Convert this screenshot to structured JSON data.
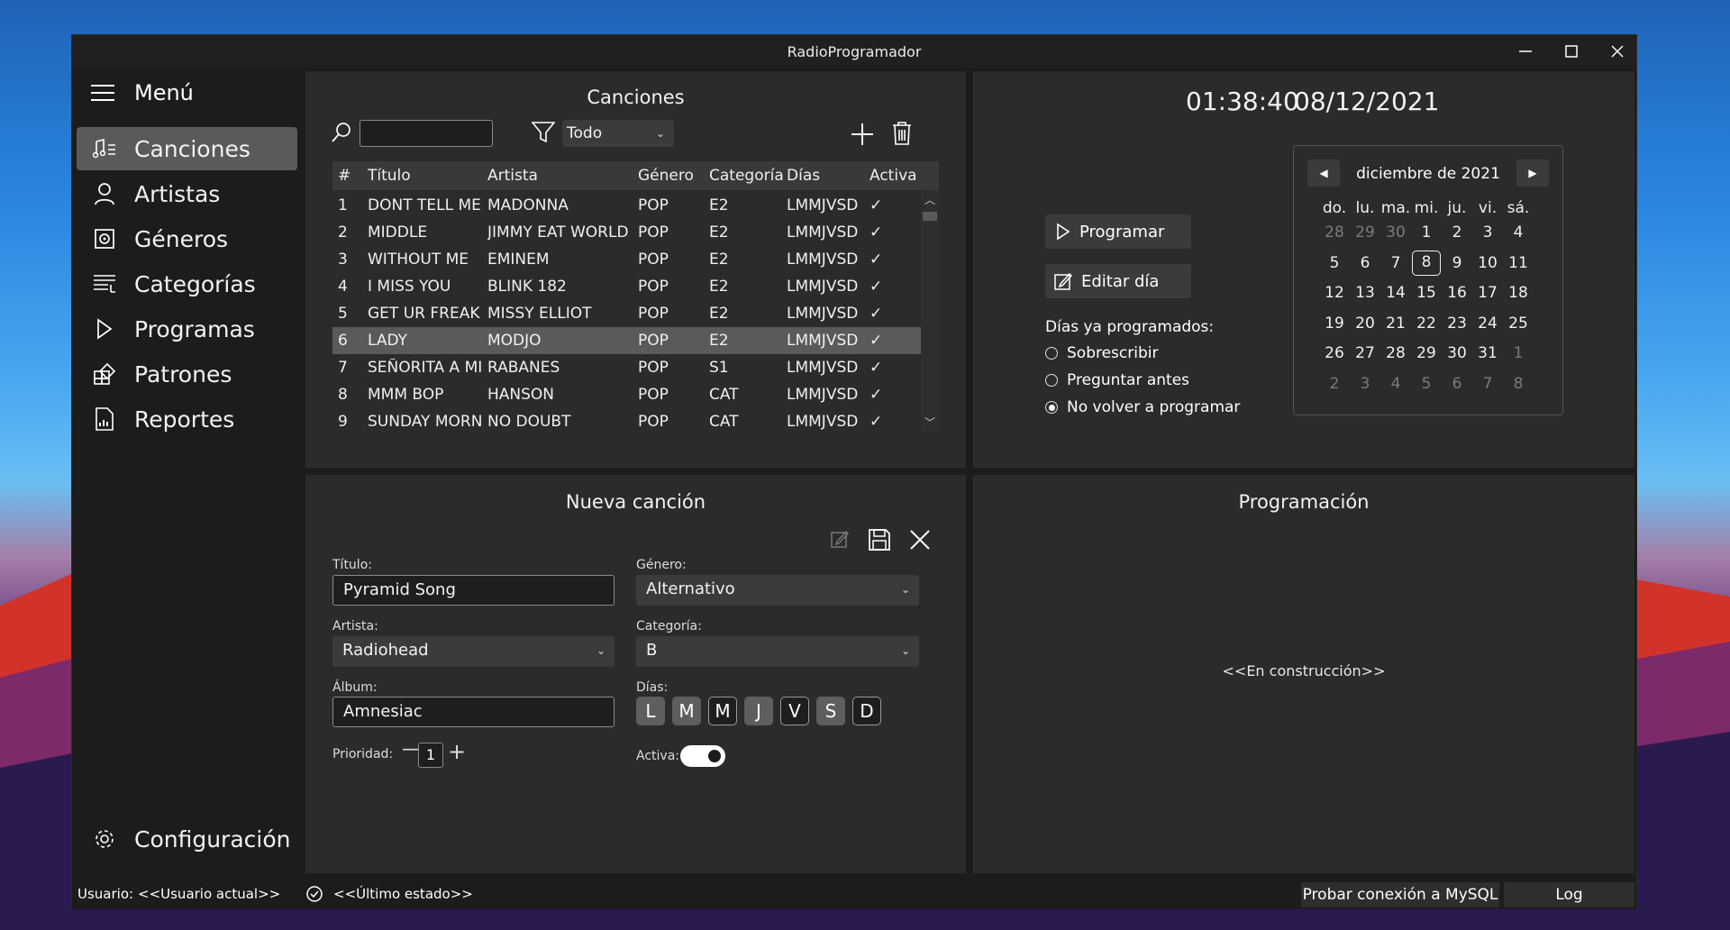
{
  "window": {
    "title": "RadioProgramador"
  },
  "sidebar": {
    "menu_label": "Menú",
    "items": [
      {
        "label": "Canciones"
      },
      {
        "label": "Artistas"
      },
      {
        "label": "Géneros"
      },
      {
        "label": "Categorías"
      },
      {
        "label": "Programas"
      },
      {
        "label": "Patrones"
      },
      {
        "label": "Reportes"
      }
    ],
    "selected": "Canciones",
    "settings_label": "Configuración"
  },
  "songs": {
    "title": "Canciones",
    "search": {
      "value": ""
    },
    "filter": {
      "selected": "Todo"
    },
    "columns": [
      "#",
      "Título",
      "Artista",
      "Género",
      "Categoría",
      "Días",
      "Activa"
    ],
    "rows": [
      {
        "n": "1",
        "title": "DONT TELL ME",
        "artist": "MADONNA",
        "genre": "POP",
        "cat": "E2",
        "days": "LMMJVSD",
        "active": "✓"
      },
      {
        "n": "2",
        "title": "MIDDLE",
        "artist": "JIMMY EAT WORLD",
        "genre": "POP",
        "cat": "E2",
        "days": "LMMJVSD",
        "active": "✓"
      },
      {
        "n": "3",
        "title": "WITHOUT ME",
        "artist": "EMINEM",
        "genre": "POP",
        "cat": "E2",
        "days": "LMMJVSD",
        "active": "✓"
      },
      {
        "n": "4",
        "title": "I MISS YOU",
        "artist": "BLINK 182",
        "genre": "POP",
        "cat": "E2",
        "days": "LMMJVSD",
        "active": "✓"
      },
      {
        "n": "5",
        "title": "GET UR FREAK (",
        "artist": "MISSY ELLIOT",
        "genre": "POP",
        "cat": "E2",
        "days": "LMMJVSD",
        "active": "✓"
      },
      {
        "n": "6",
        "title": "LADY",
        "artist": "MODJO",
        "genre": "POP",
        "cat": "E2",
        "days": "LMMJVSD",
        "active": "✓"
      },
      {
        "n": "7",
        "title": "SEÑORITA A MI",
        "artist": "RABANES",
        "genre": "POP",
        "cat": "S1",
        "days": "LMMJVSD",
        "active": "✓"
      },
      {
        "n": "8",
        "title": "MMM BOP",
        "artist": "HANSON",
        "genre": "POP",
        "cat": "CAT",
        "days": "LMMJVSD",
        "active": "✓"
      },
      {
        "n": "9",
        "title": "SUNDAY MORN",
        "artist": "NO DOUBT",
        "genre": "POP",
        "cat": "CAT",
        "days": "LMMJVSD",
        "active": "✓"
      }
    ],
    "selected_row": 6
  },
  "clock": {
    "time": "01:38:40",
    "date": "08/12/2021"
  },
  "schedule": {
    "program_label": "Programar",
    "edit_label": "Editar día",
    "already_label": "Días ya programados:",
    "options": [
      "Sobrescribir",
      "Preguntar antes",
      "No volver a programar"
    ],
    "selected_option": "No volver a programar"
  },
  "calendar": {
    "month": "diciembre de 2021",
    "weekdays": [
      "do.",
      "lu.",
      "ma.",
      "mi.",
      "ju.",
      "vi.",
      "sá."
    ],
    "weeks": [
      [
        "28",
        "29",
        "30",
        "1",
        "2",
        "3",
        "4"
      ],
      [
        "5",
        "6",
        "7",
        "8",
        "9",
        "10",
        "11"
      ],
      [
        "12",
        "13",
        "14",
        "15",
        "16",
        "17",
        "18"
      ],
      [
        "19",
        "20",
        "21",
        "22",
        "23",
        "24",
        "25"
      ],
      [
        "26",
        "27",
        "28",
        "29",
        "30",
        "31",
        "1"
      ],
      [
        "2",
        "3",
        "4",
        "5",
        "6",
        "7",
        "8"
      ]
    ],
    "today": "8"
  },
  "new_song": {
    "title": "Nueva canción",
    "title_label": "Título:",
    "title_value": "Pyramid Song",
    "artist_label": "Artista:",
    "artist_value": "Radiohead",
    "album_label": "Álbum:",
    "album_value": "Amnesiac",
    "priority_label": "Prioridad:",
    "priority_value": "1",
    "genre_label": "Género:",
    "genre_value": "Alternativo",
    "category_label": "Categoría:",
    "category_value": "B",
    "days_label": "Días:",
    "days": [
      {
        "label": "L",
        "on": true
      },
      {
        "label": "M",
        "on": true
      },
      {
        "label": "M",
        "on": false
      },
      {
        "label": "J",
        "on": true
      },
      {
        "label": "V",
        "on": false
      },
      {
        "label": "S",
        "on": true
      },
      {
        "label": "D",
        "on": false
      }
    ],
    "active_label": "Activa:",
    "active": true
  },
  "programming": {
    "title": "Programación",
    "placeholder": "<<En construcción>>"
  },
  "status": {
    "user_label": "Usuario:",
    "user_value": "<<Usuario actual>>",
    "last_state": "<<Último estado>>",
    "mysql_button": "Probar conexión a MySQL",
    "log_button": "Log"
  },
  "colors": {
    "window_bg": "#1c1c1c",
    "panel_bg": "#2b2b2b",
    "selection": "#5a5a5a"
  }
}
